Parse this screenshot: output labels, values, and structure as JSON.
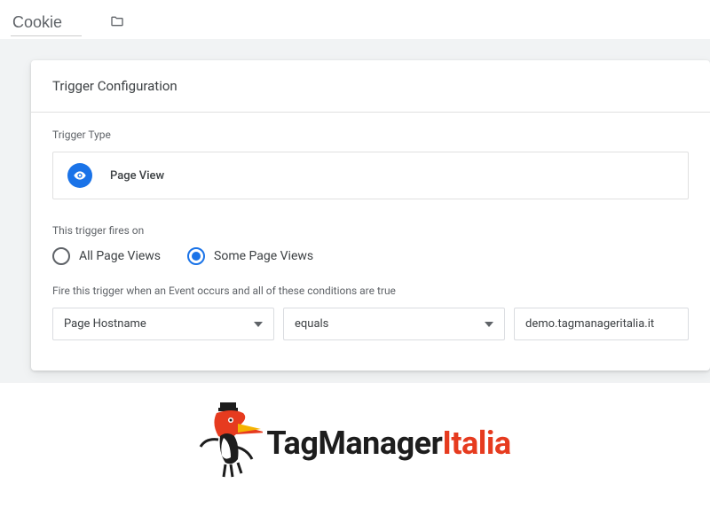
{
  "topbar": {
    "name_value": "Cookie"
  },
  "card": {
    "header": "Trigger Configuration",
    "type_label": "Trigger Type",
    "type_value": "Page View",
    "fires_on_label": "This trigger fires on",
    "radio_all": "All Page Views",
    "radio_some": "Some Page Views",
    "condition_label": "Fire this trigger when an Event occurs and all of these conditions are true",
    "cond_variable": "Page Hostname",
    "cond_operator": "equals",
    "cond_value": "demo.tagmanageritalia.it"
  },
  "logo": {
    "part1": "TagManager",
    "part2": "Italia"
  }
}
